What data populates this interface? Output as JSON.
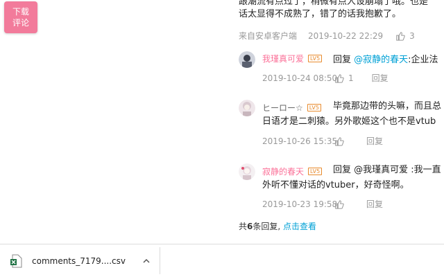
{
  "download_float": {
    "line1": "下载",
    "line2": "评论"
  },
  "main_comment": {
    "text": "跟潮流有点过了，稍微有点人设崩塌了哦。也是",
    "text2": "话太显得不成熟了，错了的话我抱歉了。",
    "source": "来自安卓客户端",
    "date": "2019-10-22 22:29",
    "likes": "3"
  },
  "replies": [
    {
      "name": "我瑾真可爱",
      "level": "LV5",
      "reply_word": "回复",
      "mention": "@寂静的春天",
      "text": ":企业法",
      "date": "2019-10-24 08:50",
      "likes": "1",
      "reply_label": "回复",
      "name_color": "#fb7299"
    },
    {
      "name": "ヒーロー☆",
      "level": "LV5",
      "text_line1": "毕竟那边带的头嘛，而且总",
      "text_line2": "日语才是二刺猿。另外歌姬这个也不是vtub",
      "date": "2019-10-26 15:35",
      "likes": "",
      "reply_label": "回复",
      "name_color": "#666666"
    },
    {
      "name": "寂静的春天",
      "level": "LV5",
      "text_line1": "回复 @我瑾真可爱 :我一直",
      "text_line2": "外听不懂对话的vtuber，好奇怪啊。",
      "date": "2019-10-23 19:58",
      "likes": "",
      "reply_label": "回复",
      "name_color": "#fb7299"
    }
  ],
  "summary": {
    "prefix": "共",
    "count": "6",
    "suffix": "条回复,",
    "link": "点击查看"
  },
  "download_bar": {
    "filename": "comments_7179....csv"
  },
  "colors": {
    "accent_pink": "#fb7299",
    "link_blue": "#00a1d6",
    "float_bg": "#f27b9b"
  }
}
